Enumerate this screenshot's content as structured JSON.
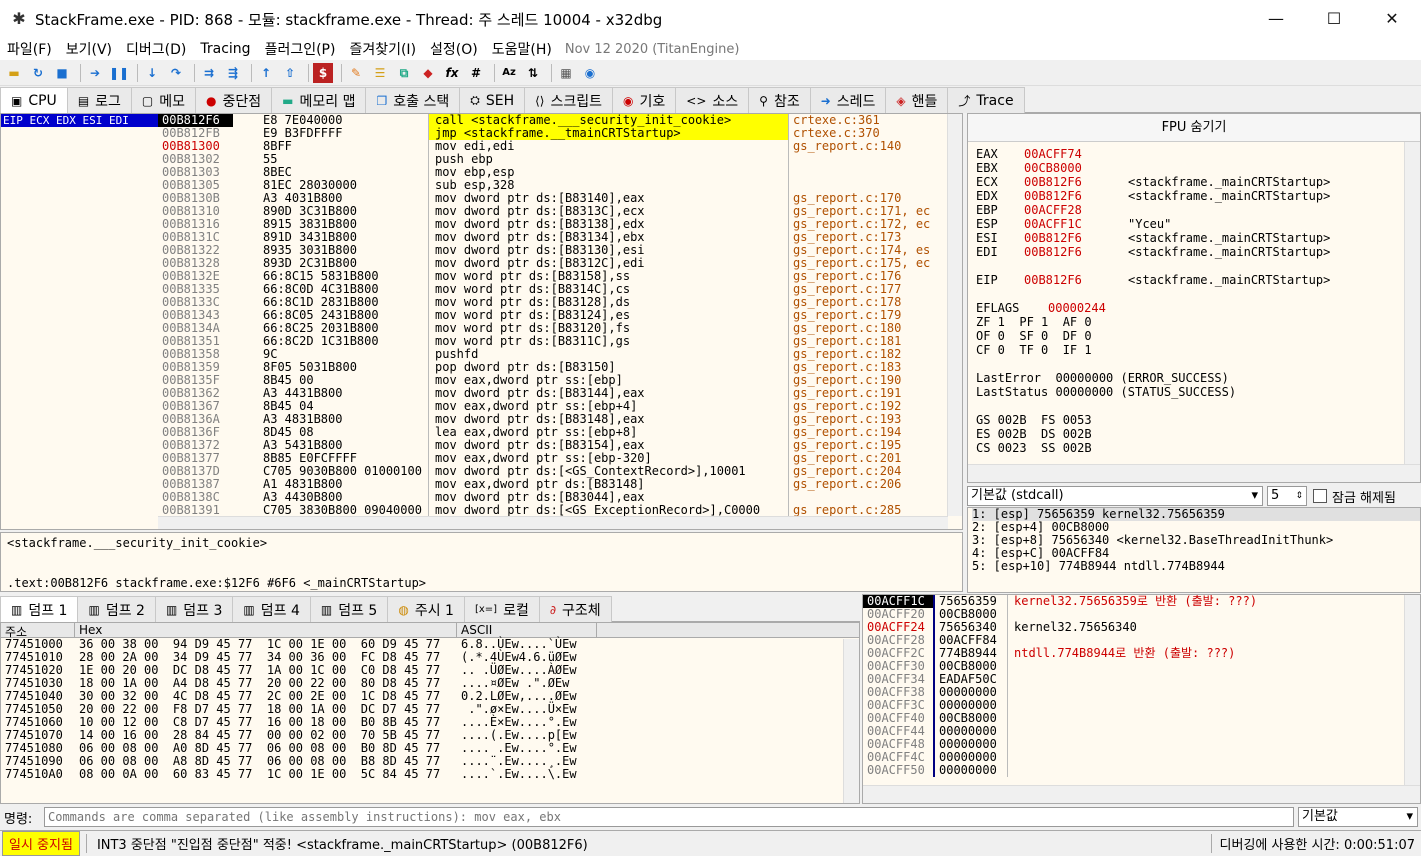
{
  "window": {
    "title": "StackFrame.exe - PID: 868 - 모듈: stackframe.exe - Thread: 주 스레드 10004 - x32dbg",
    "minimize": "—",
    "maximize": "☐",
    "close": "✕"
  },
  "menu": [
    "파일(F)",
    "보기(V)",
    "디버그(D)",
    "Tracing",
    "플러그인(P)",
    "즐겨찾기(I)",
    "설정(O)",
    "도움말(H)"
  ],
  "build_date": "Nov 12 2020 (TitanEngine)",
  "tabs": [
    "CPU",
    "로그",
    "메모",
    "중단점",
    "메모리 맵",
    "호출 스택",
    "SEH",
    "스크립트",
    "기호",
    "소스",
    "참조",
    "스레드",
    "핸들",
    "Trace"
  ],
  "reg_markers": "EIP ECX EDX ESI EDI",
  "disasm": [
    {
      "addr": "00B812F6",
      "bytes": "E8 7E040000",
      "instr": "call <stackframe.___security_init_cookie>",
      "comment": "crtexe.c:361"
    },
    {
      "addr": "00B812FB",
      "bytes": "E9 B3FDFFFF",
      "instr": "jmp <stackframe.__tmainCRTStartup>",
      "comment": "crtexe.c:370"
    },
    {
      "addr": "00B81300",
      "bytes": "8BFF",
      "instr": "mov edi,edi",
      "comment": "gs_report.c:140"
    },
    {
      "addr": "00B81302",
      "bytes": "55",
      "instr": "push ebp",
      "comment": ""
    },
    {
      "addr": "00B81303",
      "bytes": "8BEC",
      "instr": "mov ebp,esp",
      "comment": ""
    },
    {
      "addr": "00B81305",
      "bytes": "81EC 28030000",
      "instr": "sub esp,328",
      "comment": ""
    },
    {
      "addr": "00B8130B",
      "bytes": "A3 4031B800",
      "instr": "mov dword ptr ds:[B83140],eax",
      "comment": "gs_report.c:170"
    },
    {
      "addr": "00B81310",
      "bytes": "890D 3C31B800",
      "instr": "mov dword ptr ds:[B8313C],ecx",
      "comment": "gs_report.c:171, ec"
    },
    {
      "addr": "00B81316",
      "bytes": "8915 3831B800",
      "instr": "mov dword ptr ds:[B83138],edx",
      "comment": "gs_report.c:172, ec"
    },
    {
      "addr": "00B8131C",
      "bytes": "891D 3431B800",
      "instr": "mov dword ptr ds:[B83134],ebx",
      "comment": "gs_report.c:173"
    },
    {
      "addr": "00B81322",
      "bytes": "8935 3031B800",
      "instr": "mov dword ptr ds:[B83130],esi",
      "comment": "gs_report.c:174, es"
    },
    {
      "addr": "00B81328",
      "bytes": "893D 2C31B800",
      "instr": "mov dword ptr ds:[B8312C],edi",
      "comment": "gs_report.c:175, ec"
    },
    {
      "addr": "00B8132E",
      "bytes": "66:8C15 5831B800",
      "instr": "mov word ptr ds:[B83158],ss",
      "comment": "gs_report.c:176"
    },
    {
      "addr": "00B81335",
      "bytes": "66:8C0D 4C31B800",
      "instr": "mov word ptr ds:[B8314C],cs",
      "comment": "gs_report.c:177"
    },
    {
      "addr": "00B8133C",
      "bytes": "66:8C1D 2831B800",
      "instr": "mov word ptr ds:[B83128],ds",
      "comment": "gs_report.c:178"
    },
    {
      "addr": "00B81343",
      "bytes": "66:8C05 2431B800",
      "instr": "mov word ptr ds:[B83124],es",
      "comment": "gs_report.c:179"
    },
    {
      "addr": "00B8134A",
      "bytes": "66:8C25 2031B800",
      "instr": "mov word ptr ds:[B83120],fs",
      "comment": "gs_report.c:180"
    },
    {
      "addr": "00B81351",
      "bytes": "66:8C2D 1C31B800",
      "instr": "mov word ptr ds:[B8311C],gs",
      "comment": "gs_report.c:181"
    },
    {
      "addr": "00B81358",
      "bytes": "9C",
      "instr": "pushfd",
      "comment": "gs_report.c:182"
    },
    {
      "addr": "00B81359",
      "bytes": "8F05 5031B800",
      "instr": "pop dword ptr ds:[B83150]",
      "comment": "gs_report.c:183"
    },
    {
      "addr": "00B8135F",
      "bytes": "8B45 00",
      "instr": "mov eax,dword ptr ss:[ebp]",
      "comment": "gs_report.c:190"
    },
    {
      "addr": "00B81362",
      "bytes": "A3 4431B800",
      "instr": "mov dword ptr ds:[B83144],eax",
      "comment": "gs_report.c:191"
    },
    {
      "addr": "00B81367",
      "bytes": "8B45 04",
      "instr": "mov eax,dword ptr ss:[ebp+4]",
      "comment": "gs_report.c:192"
    },
    {
      "addr": "00B8136A",
      "bytes": "A3 4831B800",
      "instr": "mov dword ptr ds:[B83148],eax",
      "comment": "gs_report.c:193"
    },
    {
      "addr": "00B8136F",
      "bytes": "8D45 08",
      "instr": "lea eax,dword ptr ss:[ebp+8]",
      "comment": "gs_report.c:194"
    },
    {
      "addr": "00B81372",
      "bytes": "A3 5431B800",
      "instr": "mov dword ptr ds:[B83154],eax",
      "comment": "gs_report.c:195"
    },
    {
      "addr": "00B81377",
      "bytes": "8B85 E0FCFFFF",
      "instr": "mov eax,dword ptr ss:[ebp-320]",
      "comment": "gs_report.c:201"
    },
    {
      "addr": "00B8137D",
      "bytes": "C705 9030B800 01000100",
      "instr": "mov dword ptr ds:[<GS_ContextRecord>],10001",
      "comment": "gs_report.c:204"
    },
    {
      "addr": "00B81387",
      "bytes": "A1 4831B800",
      "instr": "mov eax,dword ptr ds:[B83148]",
      "comment": "gs_report.c:206"
    },
    {
      "addr": "00B8138C",
      "bytes": "A3 4430B800",
      "instr": "mov dword ptr ds:[B83044],eax",
      "comment": ""
    },
    {
      "addr": "00B81391",
      "bytes": "C705 3830B800 09040000",
      "instr": "mov dword ptr ds:[<GS_ExceptionRecord>],C0000",
      "comment": "gs_report.c:285"
    }
  ],
  "info": {
    "line1": "<stackframe.___security_init_cookie>",
    "line2": ".text:00B812F6 stackframe.exe:$12F6 #6F6 <_mainCRTStartup>"
  },
  "fpu_toggle": "FPU 숨기기",
  "registers": [
    {
      "name": "EAX",
      "val": "00ACFF74",
      "cmt": ""
    },
    {
      "name": "EBX",
      "val": "00CB8000",
      "cmt": ""
    },
    {
      "name": "ECX",
      "val": "00B812F6",
      "cmt": "<stackframe._mainCRTStartup>"
    },
    {
      "name": "EDX",
      "val": "00B812F6",
      "cmt": "<stackframe._mainCRTStartup>"
    },
    {
      "name": "EBP",
      "val": "00ACFF28",
      "cmt": ""
    },
    {
      "name": "ESP",
      "val": "00ACFF1C",
      "cmt": "\"Yceu\""
    },
    {
      "name": "ESI",
      "val": "00B812F6",
      "cmt": "<stackframe._mainCRTStartup>"
    },
    {
      "name": "EDI",
      "val": "00B812F6",
      "cmt": "<stackframe._mainCRTStartup>"
    },
    {
      "name": "",
      "val": "",
      "cmt": ""
    },
    {
      "name": "EIP",
      "val": "00B812F6",
      "cmt": "<stackframe._mainCRTStartup>"
    }
  ],
  "eflags": {
    "label": "EFLAGS",
    "value": "00000244"
  },
  "flags_lines": [
    "ZF 1  PF 1  AF 0",
    "OF 0  SF 0  DF 0",
    "CF 0  TF 0  IF 1"
  ],
  "last_error": "LastError  00000000 (ERROR_SUCCESS)",
  "last_status": "LastStatus 00000000 (STATUS_SUCCESS)",
  "segments": [
    "GS 002B  FS 0053",
    "ES 002B  DS 002B",
    "CS 0023  SS 002B"
  ],
  "call_conv": {
    "selected": "기본값 (stdcall)",
    "count": "5",
    "lock_label": "잠금 해제됨"
  },
  "stack_args": [
    "1: [esp] 75656359 kernel32.75656359",
    "2: [esp+4] 00CB8000",
    "3: [esp+8] 75656340 <kernel32.BaseThreadInitThunk>",
    "4: [esp+C] 00ACFF84",
    "5: [esp+10] 774B8944 ntdll.774B8944"
  ],
  "bottom_tabs": [
    "덤프 1",
    "덤프 2",
    "덤프 3",
    "덤프 4",
    "덤프 5",
    "주시 1",
    "로컬",
    "구조체"
  ],
  "dump_head": {
    "addr": "주소",
    "hex": "Hex",
    "ascii": "ASCII"
  },
  "dump": [
    {
      "a": "77451000",
      "h": "36 00 38 00  94 D9 45 77  1C 00 1E 00  60 D9 45 77",
      "c": "6.8..ÙEw....`ÙEw"
    },
    {
      "a": "77451010",
      "h": "28 00 2A 00  34 D9 45 77  34 00 36 00  FC D8 45 77",
      "c": "(.*.4ÙEw4.6.üØEw"
    },
    {
      "a": "77451020",
      "h": "1E 00 20 00  DC D8 45 77  1A 00 1C 00  C0 D8 45 77",
      "c": ".. .ÜØEw....ÀØEw"
    },
    {
      "a": "77451030",
      "h": "18 00 1A 00  A4 D8 45 77  20 00 22 00  80 D8 45 77",
      "c": "....¤ØEw .\".ØEw"
    },
    {
      "a": "77451040",
      "h": "30 00 32 00  4C D8 45 77  2C 00 2E 00  1C D8 45 77",
      "c": "0.2.LØEw,....ØEw"
    },
    {
      "a": "77451050",
      "h": "20 00 22 00  F8 D7 45 77  18 00 1A 00  DC D7 45 77",
      "c": " .\".ø×Ew....Ü×Ew"
    },
    {
      "a": "77451060",
      "h": "10 00 12 00  C8 D7 45 77  16 00 18 00  B0 8B 45 77",
      "c": "....È×Ew....°.Ew"
    },
    {
      "a": "77451070",
      "h": "14 00 16 00  28 84 45 77  00 00 02 00  70 5B 45 77",
      "c": "....(.Ew....p[Ew"
    },
    {
      "a": "77451080",
      "h": "06 00 08 00  A0 8D 45 77  06 00 08 00  B0 8D 45 77",
      "c": ".... .Ew....°.Ew"
    },
    {
      "a": "77451090",
      "h": "06 00 08 00  A8 8D 45 77  06 00 08 00  B8 8D 45 77",
      "c": "....¨.Ew....¸.Ew"
    },
    {
      "a": "774510A0",
      "h": "08 00 0A 00  60 83 45 77  1C 00 1E 00  5C 84 45 77",
      "c": "....`.Ew....\\.Ew"
    }
  ],
  "stack": [
    {
      "a": "00ACFF1C",
      "v": "75656359",
      "c": "kernel32.75656359로 반환 (출발: ???)"
    },
    {
      "a": "00ACFF20",
      "v": "00CB8000",
      "c": ""
    },
    {
      "a": "00ACFF24",
      "v": "75656340",
      "c": "kernel32.75656340"
    },
    {
      "a": "00ACFF28",
      "v": "00ACFF84",
      "c": ""
    },
    {
      "a": "00ACFF2C",
      "v": "774B8944",
      "c": "ntdll.774B8944로 반환 (출발: ???)"
    },
    {
      "a": "00ACFF30",
      "v": "00CB8000",
      "c": ""
    },
    {
      "a": "00ACFF34",
      "v": "EADAF50C",
      "c": ""
    },
    {
      "a": "00ACFF38",
      "v": "00000000",
      "c": ""
    },
    {
      "a": "00ACFF3C",
      "v": "00000000",
      "c": ""
    },
    {
      "a": "00ACFF40",
      "v": "00CB8000",
      "c": ""
    },
    {
      "a": "00ACFF44",
      "v": "00000000",
      "c": ""
    },
    {
      "a": "00ACFF48",
      "v": "00000000",
      "c": ""
    },
    {
      "a": "00ACFF4C",
      "v": "00000000",
      "c": ""
    },
    {
      "a": "00ACFF50",
      "v": "00000000",
      "c": ""
    }
  ],
  "command": {
    "label": "명령:",
    "placeholder": "Commands are comma separated (like assembly instructions): mov eax, ebx",
    "mode": "기본값"
  },
  "status": {
    "state": "일시 중지됨",
    "message": "INT3 중단점 \"진입점 중단점\" 적중! <stackframe._mainCRTStartup> (00B812F6)",
    "timer": "디버깅에 사용한 시간: 0:00:51:07"
  }
}
